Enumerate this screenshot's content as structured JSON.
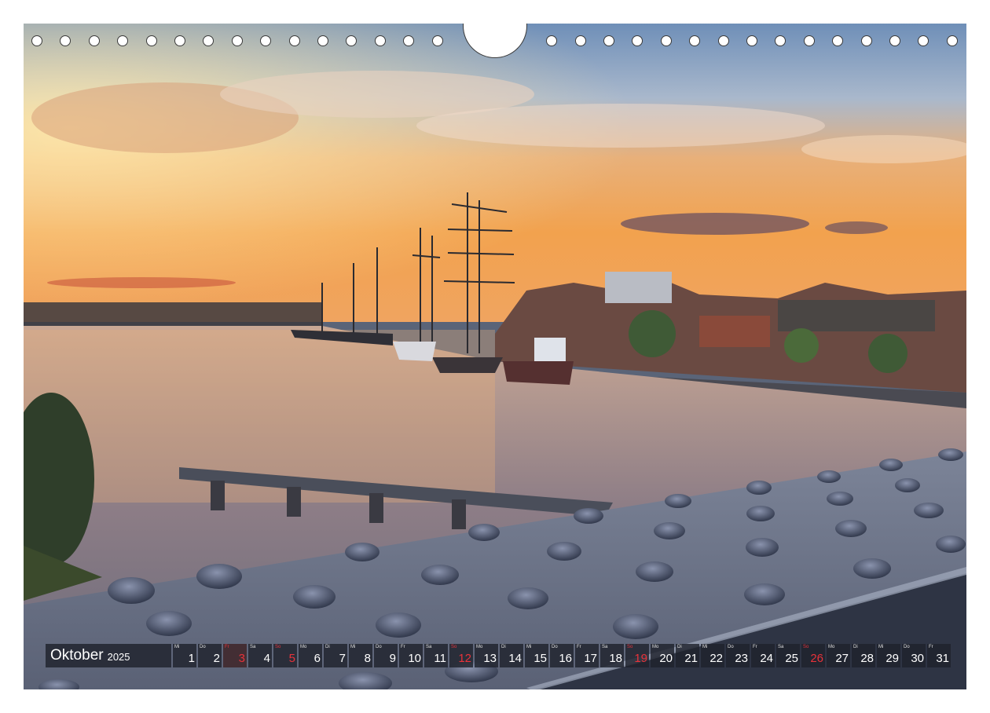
{
  "calendar": {
    "month": "Oktober",
    "year": "2025",
    "days": [
      {
        "wd": "Mi",
        "n": "1"
      },
      {
        "wd": "Do",
        "n": "2"
      },
      {
        "wd": "Fr",
        "n": "3",
        "red": true
      },
      {
        "wd": "Sa",
        "n": "4"
      },
      {
        "wd": "So",
        "n": "5",
        "red": true
      },
      {
        "wd": "Mo",
        "n": "6"
      },
      {
        "wd": "Di",
        "n": "7"
      },
      {
        "wd": "Mi",
        "n": "8"
      },
      {
        "wd": "Do",
        "n": "9"
      },
      {
        "wd": "Fr",
        "n": "10"
      },
      {
        "wd": "Sa",
        "n": "11"
      },
      {
        "wd": "So",
        "n": "12",
        "red": true
      },
      {
        "wd": "Mo",
        "n": "13"
      },
      {
        "wd": "Di",
        "n": "14"
      },
      {
        "wd": "Mi",
        "n": "15"
      },
      {
        "wd": "Do",
        "n": "16"
      },
      {
        "wd": "Fr",
        "n": "17"
      },
      {
        "wd": "Sa",
        "n": "18"
      },
      {
        "wd": "So",
        "n": "19",
        "red": true
      },
      {
        "wd": "Mo",
        "n": "20"
      },
      {
        "wd": "Di",
        "n": "21"
      },
      {
        "wd": "Mi",
        "n": "22"
      },
      {
        "wd": "Do",
        "n": "23"
      },
      {
        "wd": "Fr",
        "n": "24"
      },
      {
        "wd": "Sa",
        "n": "25"
      },
      {
        "wd": "So",
        "n": "26",
        "red": true
      },
      {
        "wd": "Mo",
        "n": "27"
      },
      {
        "wd": "Di",
        "n": "28"
      },
      {
        "wd": "Mi",
        "n": "29"
      },
      {
        "wd": "Do",
        "n": "30"
      },
      {
        "wd": "Fr",
        "n": "31"
      }
    ]
  },
  "binding": {
    "hole_count": 32
  },
  "colors": {
    "holiday_red": "#e8323a",
    "strip_bg": "#1e222c"
  }
}
